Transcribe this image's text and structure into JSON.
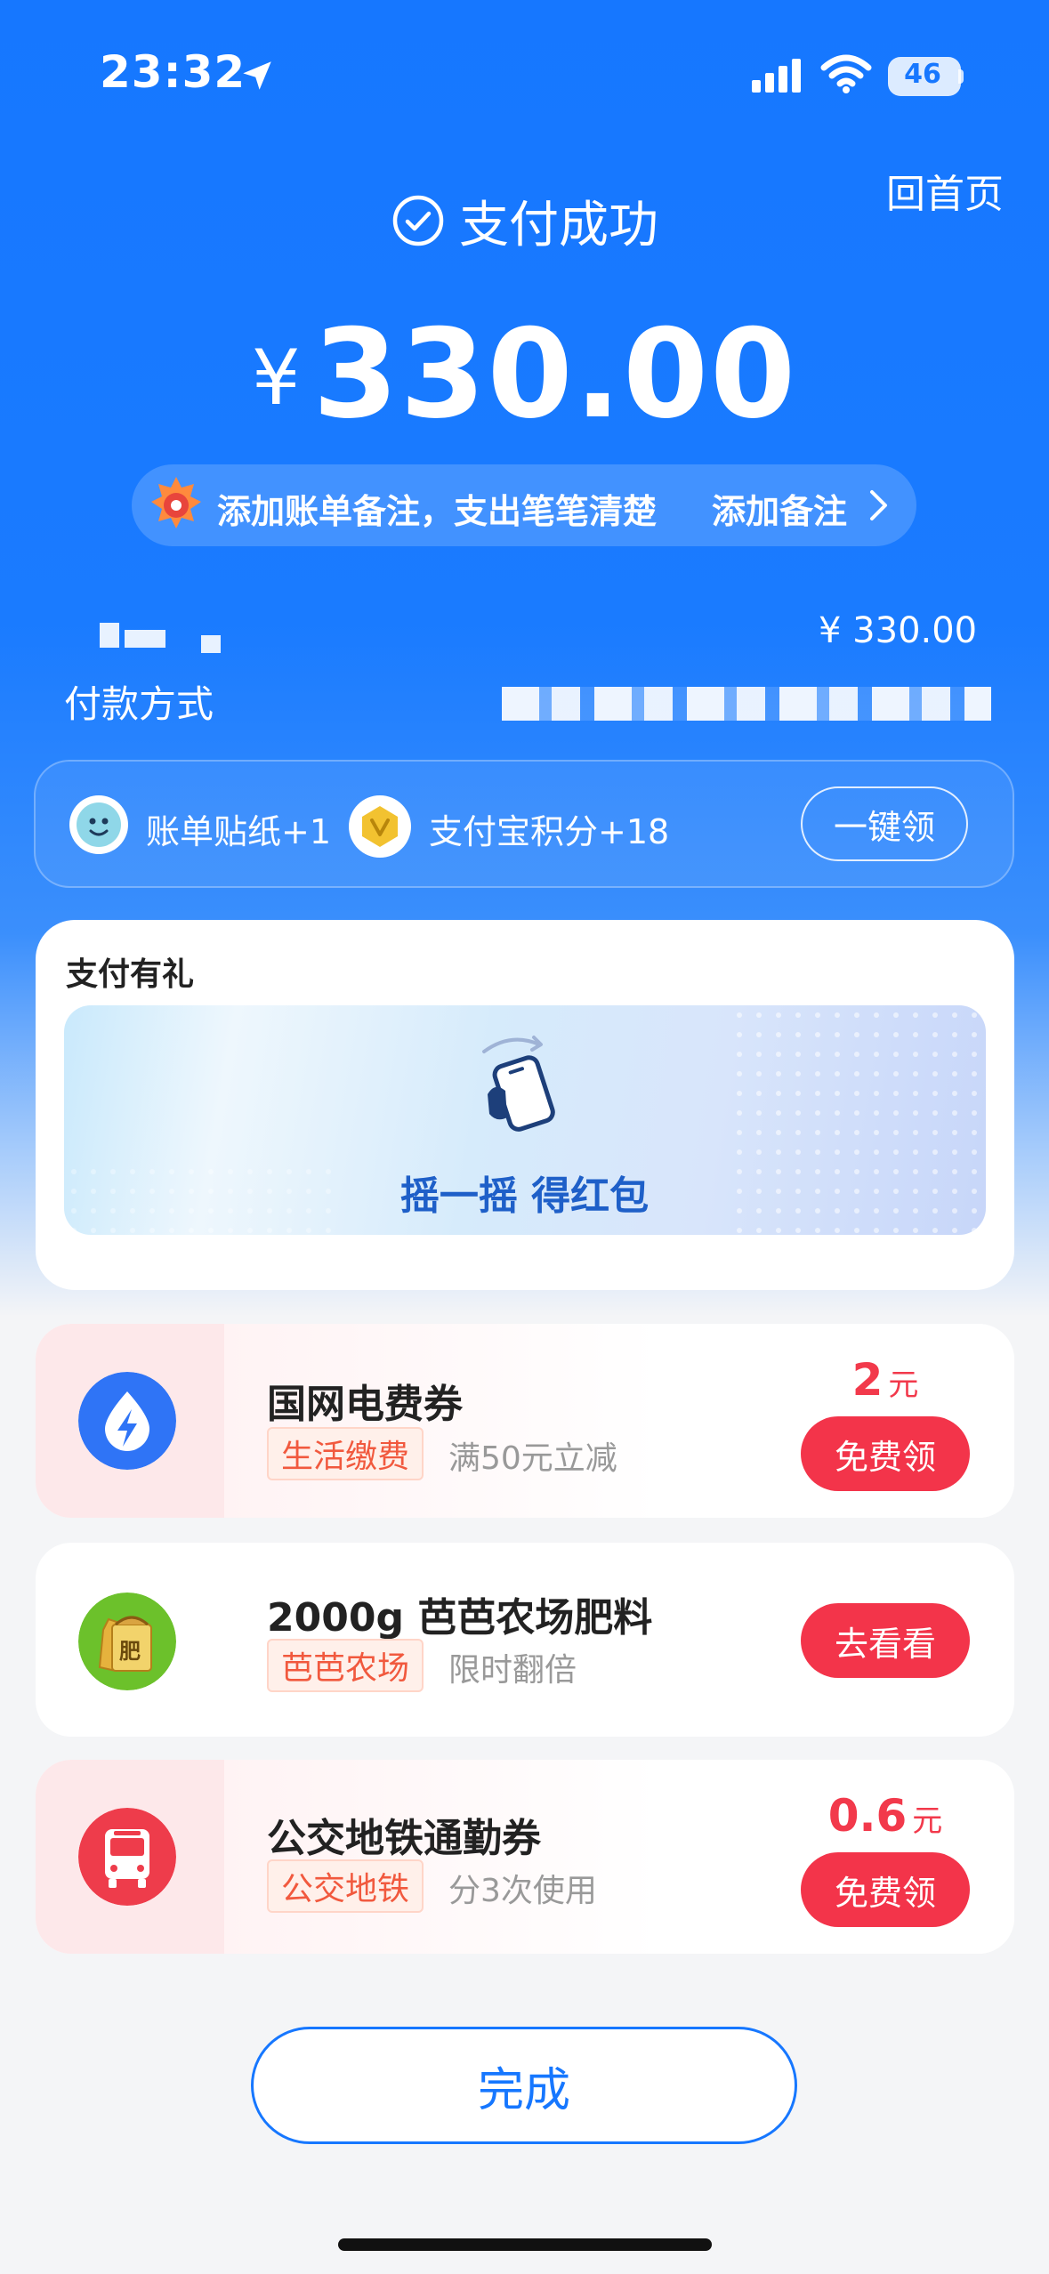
{
  "status_bar": {
    "time": "23:32",
    "battery": "46"
  },
  "header": {
    "home_link": "回首页",
    "status": "支付成功"
  },
  "payment": {
    "currency_symbol": "¥",
    "amount": "330.00",
    "paid_amount": "¥ 330.00",
    "method_label": "付款方式"
  },
  "note_banner": {
    "text": "添加账单备注，支出笔笔清楚",
    "action": "添加备注"
  },
  "rewards": {
    "items": [
      {
        "label": "账单贴纸+1"
      },
      {
        "label": "支付宝积分+18"
      }
    ],
    "claim_all": "一键领"
  },
  "gift": {
    "title": "支付有礼",
    "banner_text": "摇一摇 得红包"
  },
  "offers": [
    {
      "title": "国网电费券",
      "tag": "生活缴费",
      "desc": "满50元立减",
      "value": "2",
      "unit": "元",
      "button": "免费领",
      "icon": "electricity-bolt-icon"
    },
    {
      "title": "2000g 芭芭农场肥料",
      "tag": "芭芭农场",
      "desc": "限时翻倍",
      "button": "去看看",
      "icon": "fertilizer-bag-icon",
      "icon_text": "肥"
    },
    {
      "title": "公交地铁通勤券",
      "tag": "公交地铁",
      "desc": "分3次使用",
      "value": "0.6",
      "unit": "元",
      "button": "免费领",
      "icon": "bus-icon"
    }
  ],
  "footer": {
    "done": "完成"
  },
  "colors": {
    "brand_blue": "#1677ff",
    "accent_red": "#f3344a",
    "tag_orange": "#f1593e"
  }
}
